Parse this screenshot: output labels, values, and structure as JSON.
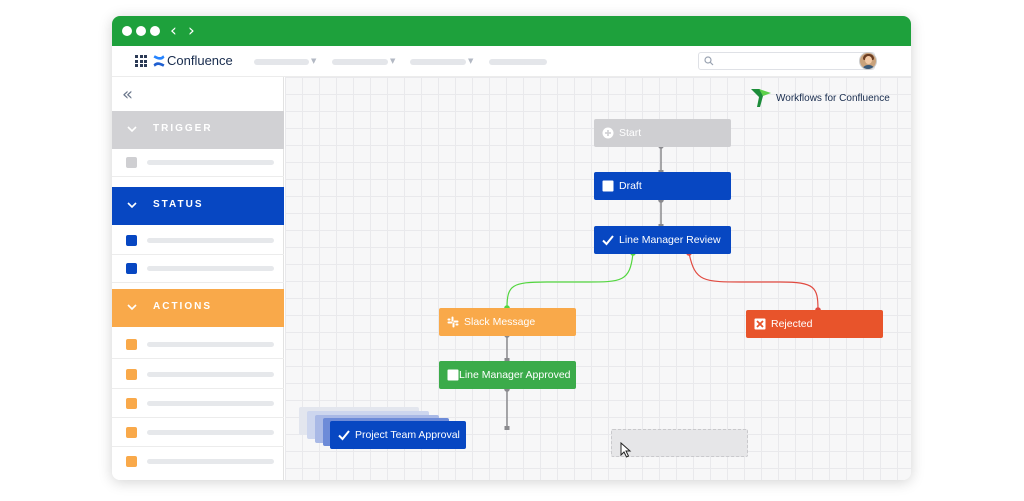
{
  "app": {
    "brand": "Confluence",
    "plugin_brand": "Workflows for Confluence"
  },
  "colors": {
    "titlebar": "#1ea13c",
    "trigger": "#d1d1d4",
    "status": "#0747c2",
    "actions": "#f9a94a",
    "start_node": "#cfcfd2",
    "draft_node": "#0747c2",
    "review_node": "#0747c2",
    "slack_node": "#f9a94a",
    "approved_node": "#3bab4a",
    "rejected_node": "#e8542b",
    "drag_node": "#0747c2",
    "approve_link": "#53d63f",
    "reject_link": "#e14a40"
  },
  "icons": {
    "apps": "app-switcher-icon",
    "logo": "confluence-logo-icon",
    "search": "search-icon",
    "collapse": "double-chevron-left-icon",
    "section": "chevron-down-icon",
    "start": "plus-circle-icon",
    "status": "square-icon",
    "check": "checkmark-icon",
    "slack": "slack-icon",
    "reject": "x-box-icon"
  },
  "sidebar": {
    "sections": [
      {
        "label": "TRIGGER",
        "items": 1
      },
      {
        "label": "STATUS",
        "items": 2
      },
      {
        "label": "ACTIONS",
        "items": 5
      }
    ]
  },
  "workflow": {
    "nodes": {
      "start": "Start",
      "draft": "Draft",
      "review": "Line Manager Review",
      "slack": "Slack Message",
      "approved": "Line Manager Approved",
      "rejected": "Rejected",
      "dragging": "Project Team Approval"
    }
  }
}
